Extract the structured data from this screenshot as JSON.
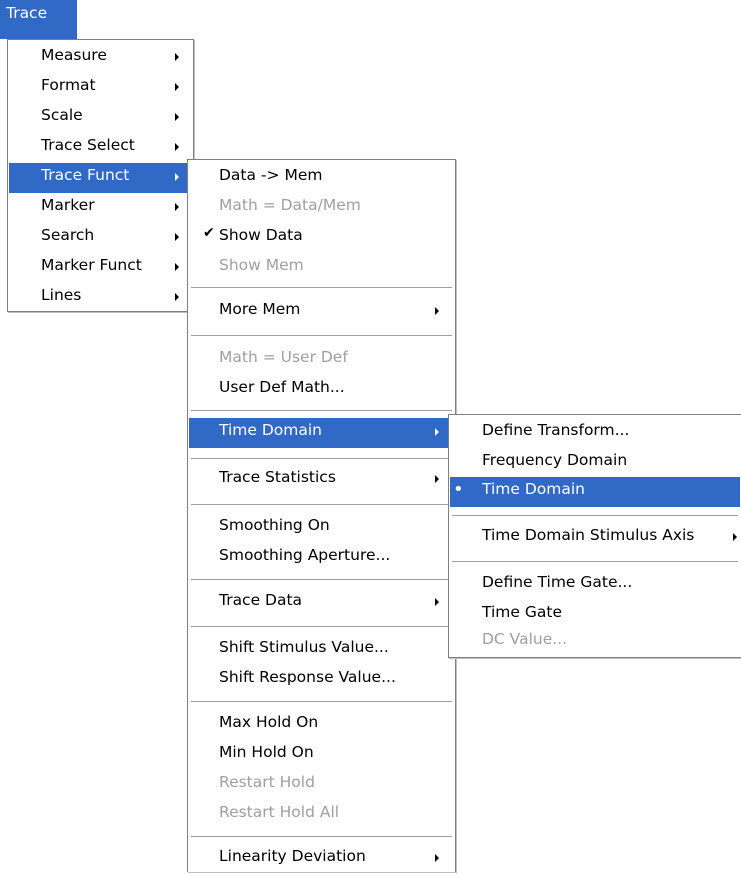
{
  "menubar": {
    "title": "Trace"
  },
  "trace_menu": {
    "items": [
      {
        "label": "Measure"
      },
      {
        "label": "Format"
      },
      {
        "label": "Scale"
      },
      {
        "label": "Trace Select"
      },
      {
        "label": "Trace Funct"
      },
      {
        "label": "Marker"
      },
      {
        "label": "Search"
      },
      {
        "label": "Marker Funct"
      },
      {
        "label": "Lines"
      }
    ]
  },
  "trace_funct_menu": {
    "items": [
      {
        "label": "Data -> Mem"
      },
      {
        "label": "Math = Data/Mem"
      },
      {
        "label": "Show Data",
        "check": "✔"
      },
      {
        "label": "Show Mem"
      },
      {
        "label": "More Mem"
      },
      {
        "label": "Math = User Def"
      },
      {
        "label": "User Def Math..."
      },
      {
        "label": "Time Domain"
      },
      {
        "label": "Trace Statistics"
      },
      {
        "label": "Smoothing On"
      },
      {
        "label": "Smoothing Aperture..."
      },
      {
        "label": "Trace Data"
      },
      {
        "label": "Shift Stimulus Value..."
      },
      {
        "label": "Shift Response Value..."
      },
      {
        "label": "Max Hold On"
      },
      {
        "label": "Min Hold On"
      },
      {
        "label": "Restart Hold"
      },
      {
        "label": "Restart Hold All"
      },
      {
        "label": "Linearity Deviation"
      }
    ]
  },
  "time_domain_menu": {
    "items": [
      {
        "label": "Define Transform..."
      },
      {
        "label": "Frequency Domain"
      },
      {
        "label": "Time Domain",
        "bullet": "•"
      },
      {
        "label": "Time Domain Stimulus Axis"
      },
      {
        "label": "Define Time Gate..."
      },
      {
        "label": "Time Gate"
      },
      {
        "label": "DC Value..."
      }
    ]
  },
  "colors": {
    "highlight": "#3169c6",
    "disabled_text": "#a0a0a0",
    "border": "#808080"
  }
}
